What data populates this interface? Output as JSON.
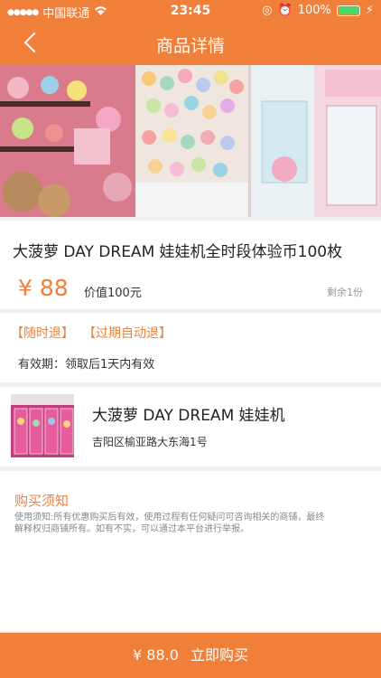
{
  "status_bar": {
    "carrier": "中国联通",
    "time": "23:45",
    "battery": "100%",
    "battery_level": 1.0
  },
  "nav": {
    "title": "商品详情"
  },
  "product": {
    "title": "大菠萝 DAY DREAM 娃娃机全时段体验币100枚",
    "price": "¥ 88",
    "original_value": "价值100元",
    "stock": "剩余1份"
  },
  "refund": {
    "tag_anytime": "【随时退】",
    "tag_expired": "【过期自动退】",
    "validity": "有效期：领取后1天内有效"
  },
  "store": {
    "name": "大菠萝 DAY DREAM 娃娃机",
    "address": "吉阳区榆亚路大东海1号"
  },
  "notice": {
    "title": "购买须知",
    "text": "使用须知:所有优惠购买后有效，使用过程有任何疑问可咨询相关的商铺，最终解释权归商铺所有。如有不实，可以通过本平台进行举报。"
  },
  "buy_bar": {
    "price": "¥ 88.0",
    "label": "立即购买"
  },
  "colors": {
    "accent": "#f07f3a"
  }
}
